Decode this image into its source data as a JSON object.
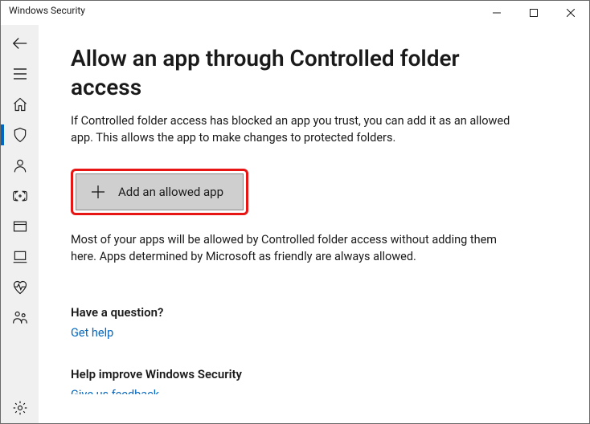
{
  "window": {
    "title": "Windows Security"
  },
  "page": {
    "heading": "Allow an app through Controlled folder access",
    "description": "If Controlled folder access has blocked an app you trust, you can add it as an allowed app. This allows the app to make changes to protected folders.",
    "add_button_label": "Add an allowed app",
    "info_text": "Most of your apps will be allowed by Controlled folder access without adding them here. Apps determined by Microsoft as friendly are always allowed.",
    "question_heading": "Have a question?",
    "question_link": "Get help",
    "improve_heading": "Help improve Windows Security",
    "improve_link": "Give us feedback"
  }
}
